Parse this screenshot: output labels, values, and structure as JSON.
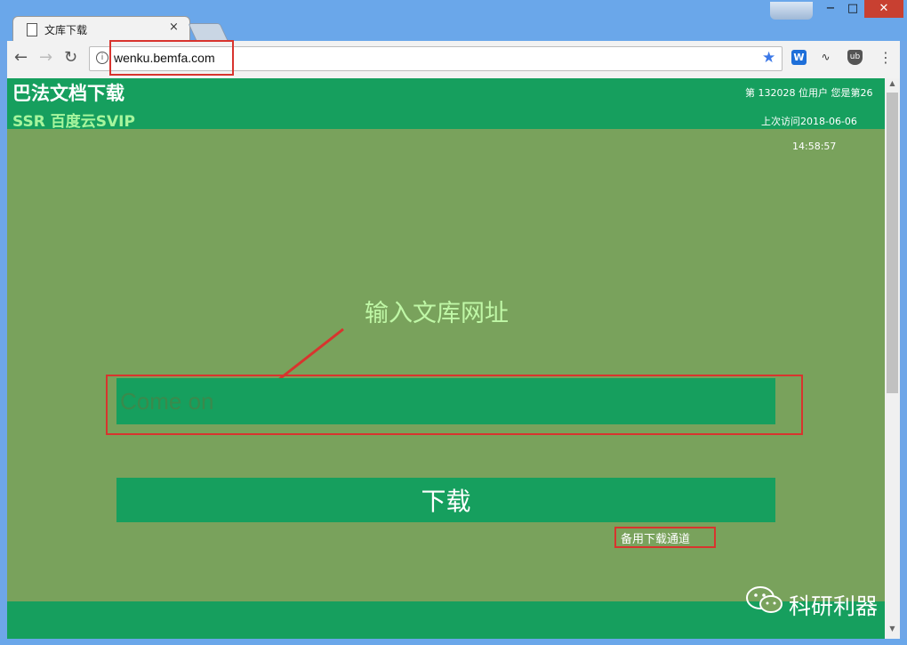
{
  "browser": {
    "tab_title": "文库下载",
    "tab_close": "×",
    "url": "wenku.bemfa.com",
    "info_icon": "i",
    "back_icon": "←",
    "forward_icon": "→",
    "reload_icon": "↻",
    "star_icon": "★",
    "menu_icon": "⋮",
    "extensions": [
      {
        "name": "word-extension-icon",
        "label": "W"
      },
      {
        "name": "signal-extension-icon",
        "label": "∿"
      },
      {
        "name": "ublock-icon",
        "label": "ub"
      }
    ],
    "window_controls": {
      "minimize": "−",
      "maximize": "□",
      "close": "✕"
    }
  },
  "site": {
    "title": "巴法文档下载",
    "subtitle": "SSR 百度云SVIP",
    "visitor_count": "第 132028 位用户 您是第26",
    "last_visit": "上次访问2018-06-06",
    "last_visit_time": "14:58:57"
  },
  "main": {
    "prompt_label": "输入文库网址",
    "input_placeholder": "Come on",
    "download_label": "下载",
    "backup_link": "备用下载通道"
  },
  "watermark": {
    "text": "科研利器",
    "icon": "wechat-icon"
  },
  "colors": {
    "page_bg": "#79a25c",
    "header_green": "#169f5e",
    "highlight_red": "#d8342e",
    "subtitle_green": "#a6f59d"
  }
}
